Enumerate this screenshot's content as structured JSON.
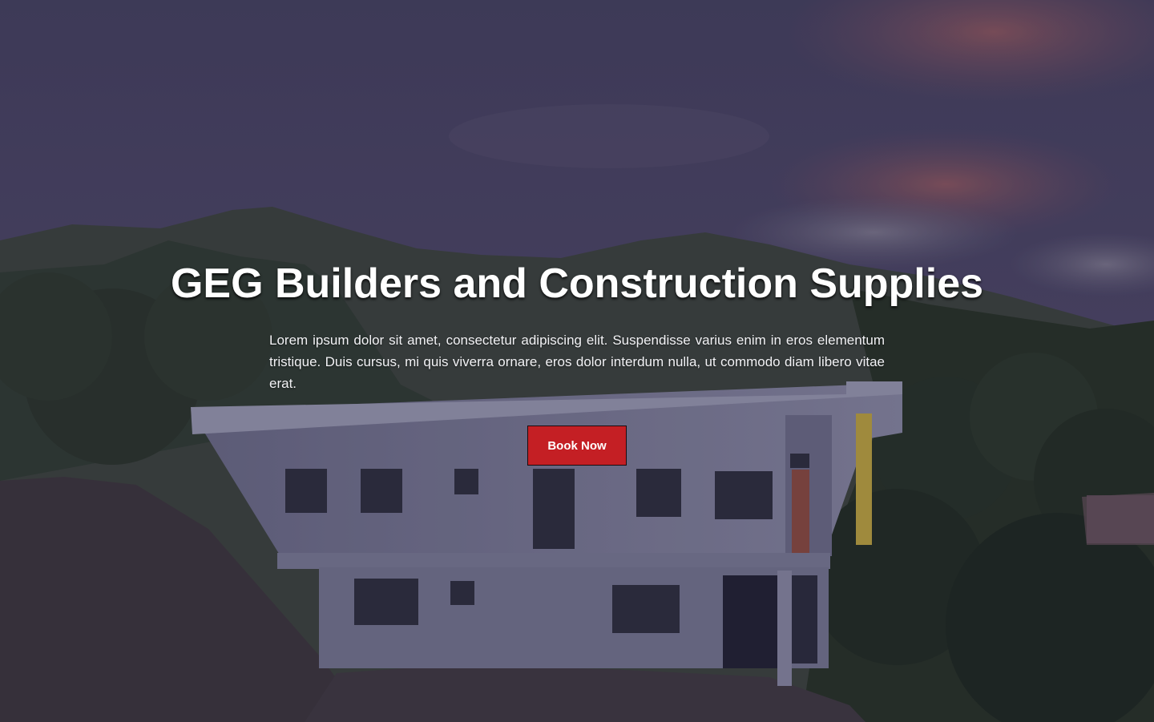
{
  "hero": {
    "title": "GEG Builders and Construction Supplies",
    "description": "Lorem ipsum dolor sit amet, consectetur adipiscing elit. Suspendisse varius enim in eros elementum tristique. Duis cursus, mi quis viverra ornare, eros dolor interdum nulla, ut commodo diam libero vitae erat.",
    "cta_label": "Book Now",
    "background": "photo of a white two-storey house on a hillside at dusk, covered by a dark purple overlay"
  },
  "colors": {
    "overlay": "#2a2848",
    "cta_background": "#c41f24",
    "title_text": "#ffffff"
  }
}
